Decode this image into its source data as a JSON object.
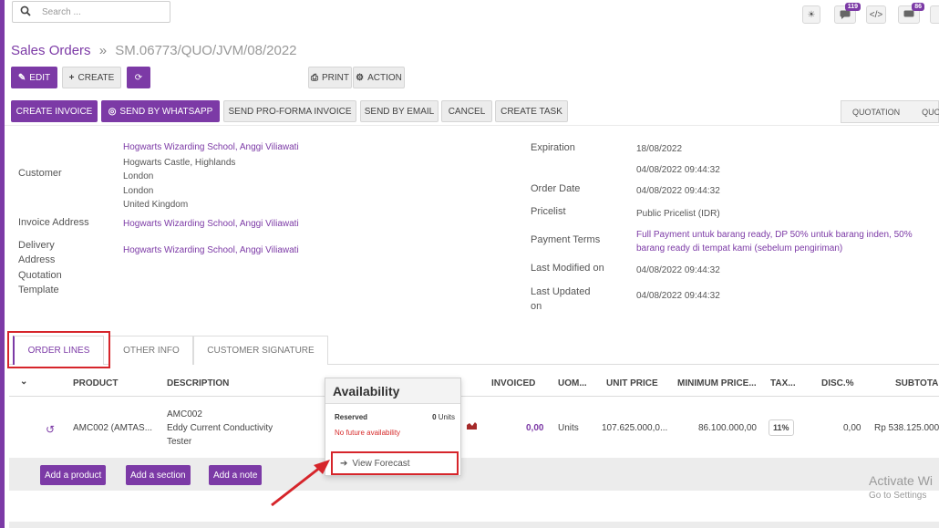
{
  "search": {
    "placeholder": "Search ..."
  },
  "topbar": {
    "bug_label": "☀",
    "chat_badge": "119",
    "code_label": "</>",
    "activity_badge": "86"
  },
  "breadcrumb": {
    "parent": "Sales Orders",
    "separator": "»",
    "current": "SM.06773/QUO/JVM/08/2022"
  },
  "toolbar": {
    "edit": "EDIT",
    "create": "CREATE",
    "print": "PRINT",
    "action": "ACTION"
  },
  "actions": {
    "create_invoice": "CREATE INVOICE",
    "send_whatsapp": "SEND BY WHATSAPP",
    "send_proforma": "SEND PRO-FORMA INVOICE",
    "send_email": "SEND BY EMAIL",
    "cancel": "CANCEL",
    "create_task": "CREATE TASK"
  },
  "stages": [
    "QUOTATION",
    "QUOT"
  ],
  "form": {
    "customer_label": "Customer",
    "customer_name": "Hogwarts Wizarding School, Anggi Viliawati",
    "customer_addr1": "Hogwarts Castle, Highlands",
    "customer_addr2": "London",
    "customer_addr3": "London",
    "customer_addr4": "United Kingdom",
    "invoice_label": "Invoice Address",
    "invoice_value": "Hogwarts Wizarding School, Anggi Viliawati",
    "delivery_label1": "Delivery",
    "delivery_label2": "Address",
    "delivery_value": "Hogwarts Wizarding School, Anggi Viliawati",
    "template_label1": "Quotation",
    "template_label2": "Template",
    "expiration_label": "Expiration",
    "expiration_value": "18/08/2022",
    "expiration_value2": "04/08/2022 09:44:32",
    "order_date_label": "Order Date",
    "order_date_value": "04/08/2022 09:44:32",
    "pricelist_label": "Pricelist",
    "pricelist_value": "Public Pricelist (IDR)",
    "payment_label": "Payment Terms",
    "payment_value1": "Full Payment untuk barang ready, DP 50% untuk barang inden, 50%",
    "payment_value2": "barang ready di tempat kami (sebelum pengiriman)",
    "last_modified_label": "Last Modified on",
    "last_modified_value": "04/08/2022 09:44:32",
    "last_updated_label1": "Last Updated",
    "last_updated_label2": "on",
    "last_updated_value": "04/08/2022 09:44:32"
  },
  "tabs": {
    "order_lines": "ORDER LINES",
    "other_info": "OTHER INFO",
    "customer_signature": "CUSTOMER SIGNATURE"
  },
  "table": {
    "headers": {
      "product": "PRODUCT",
      "description": "DESCRIPTION",
      "invoiced": "INVOICED",
      "uom": "UOM...",
      "unit_price": "UNIT PRICE",
      "min_price": "MINIMUM PRICE...",
      "tax": "TAX...",
      "disc": "DISC.%",
      "subtotal": "SUBTOTAL"
    },
    "row": {
      "product": "AMC002 (AMTAS...",
      "desc1": "AMC002",
      "desc2": "Eddy Current Conductivity",
      "desc3": "Tester",
      "invoiced": "0,00",
      "uom": "Units",
      "unit_price": "107.625.000,0...",
      "min_price": "86.100.000,00",
      "tax": "11%",
      "disc": "0,00",
      "subtotal": "Rp 538.125.000"
    },
    "add_product": "Add a product",
    "add_section": "Add a section",
    "add_note": "Add a note"
  },
  "popover": {
    "title": "Availability",
    "reserved_label": "Reserved",
    "reserved_value": "0",
    "reserved_unit": "Units",
    "warning": "No future availability",
    "view_forecast": "View Forecast"
  },
  "watermark": {
    "line1": "Activate Wi",
    "line2": "Go to Settings"
  },
  "colors": {
    "brand": "#7c3aa6",
    "highlight": "#d6252b"
  }
}
